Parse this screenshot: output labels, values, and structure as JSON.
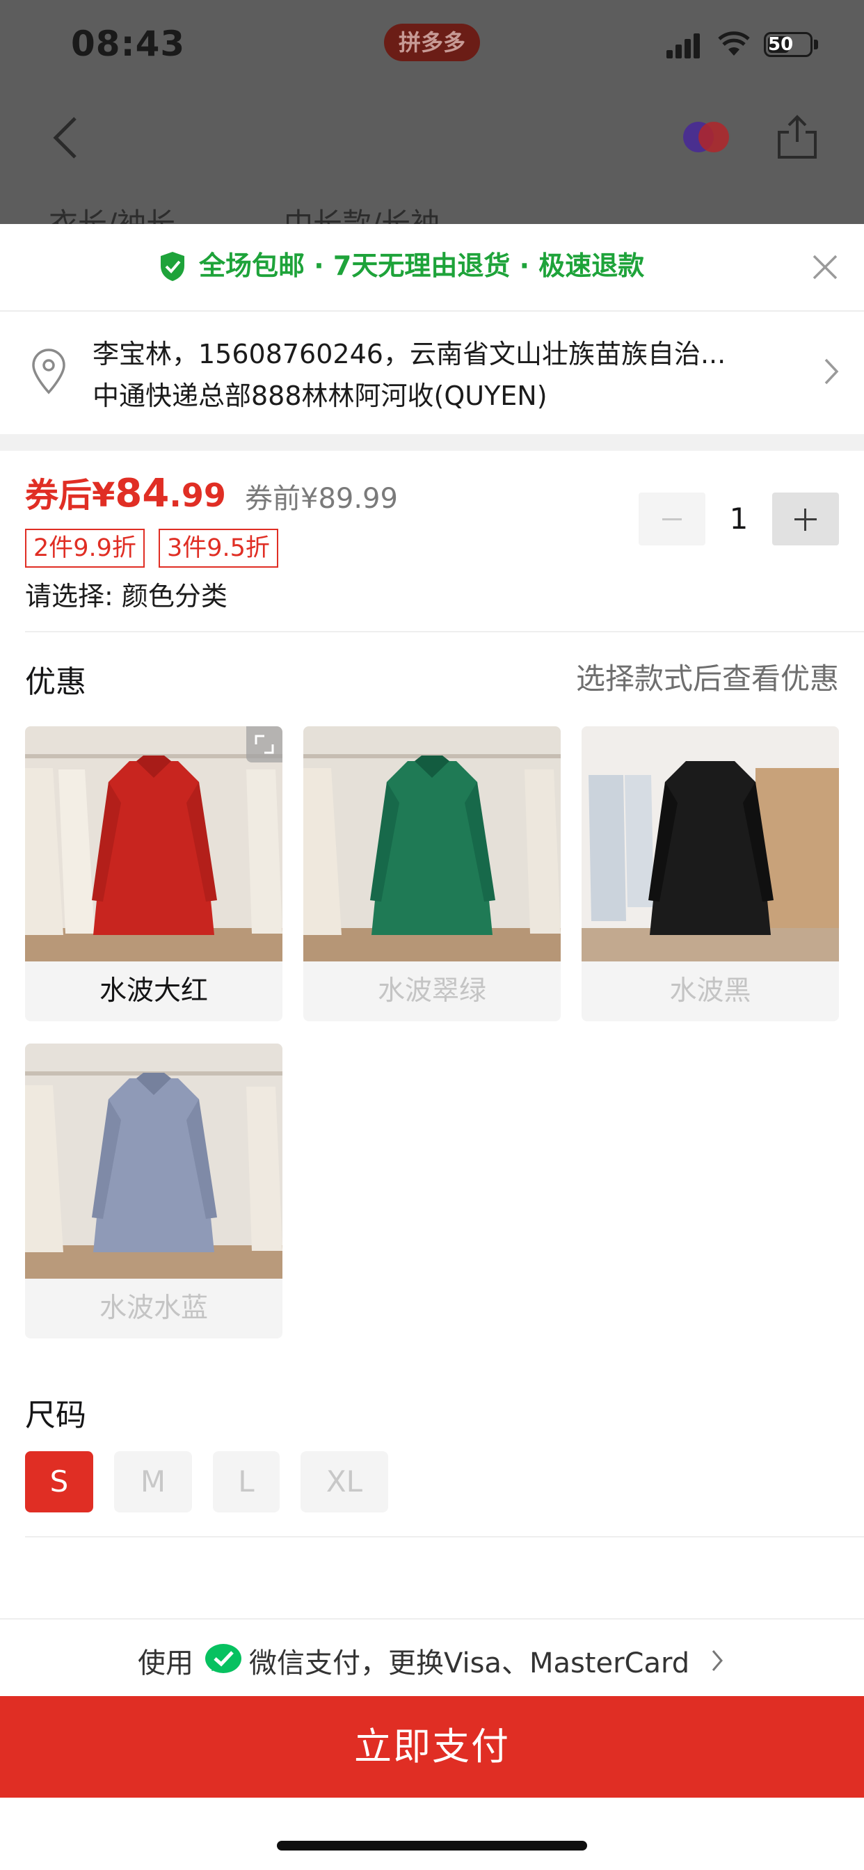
{
  "status_bar": {
    "time": "08:43",
    "app_badge": "拼多多",
    "battery": "50"
  },
  "background_page": {
    "attr_labels": [
      "衣长/袖长",
      "中长款/长袖"
    ]
  },
  "sheet": {
    "promo": "全场包邮 · 7天无理由退货 · 极速退款",
    "address": {
      "line1": "李宝林，15608760246，云南省文山壮族苗族自治...",
      "line2": "中通快递总部888林林阿河收(QUYEN)"
    },
    "price": {
      "label": "券后",
      "currency": "¥",
      "integer": "84",
      "decimal": ".99",
      "before": "券前¥89.99"
    },
    "quantity": "1",
    "tags": [
      "2件9.9折",
      "3件9.5折"
    ],
    "select_prompt": "请选择: 颜色分类",
    "discount_section": {
      "title": "优惠",
      "hint": "选择款式后查看优惠"
    },
    "colors": [
      {
        "name": "水波大红",
        "state": "active",
        "coat_color": "#c8251f"
      },
      {
        "name": "水波翠绿",
        "state": "disabled",
        "coat_color": "#1f7a55"
      },
      {
        "name": "水波黑",
        "state": "disabled",
        "coat_color": "#1b1b1b"
      },
      {
        "name": "水波水蓝",
        "state": "disabled",
        "coat_color": "#8f9ab7"
      }
    ],
    "size_section": {
      "title": "尺码",
      "sizes": [
        {
          "label": "S",
          "state": "active"
        },
        {
          "label": "M",
          "state": "disabled"
        },
        {
          "label": "L",
          "state": "disabled"
        },
        {
          "label": "XL",
          "state": "disabled"
        }
      ]
    },
    "payment": {
      "prefix": "使用",
      "method": "微信支付，更换Visa、MasterCard",
      "button": "立即支付"
    }
  },
  "colors": {
    "accent": "#e02e24",
    "promo_green": "#1ea33a",
    "wechat_green": "#07c160"
  }
}
